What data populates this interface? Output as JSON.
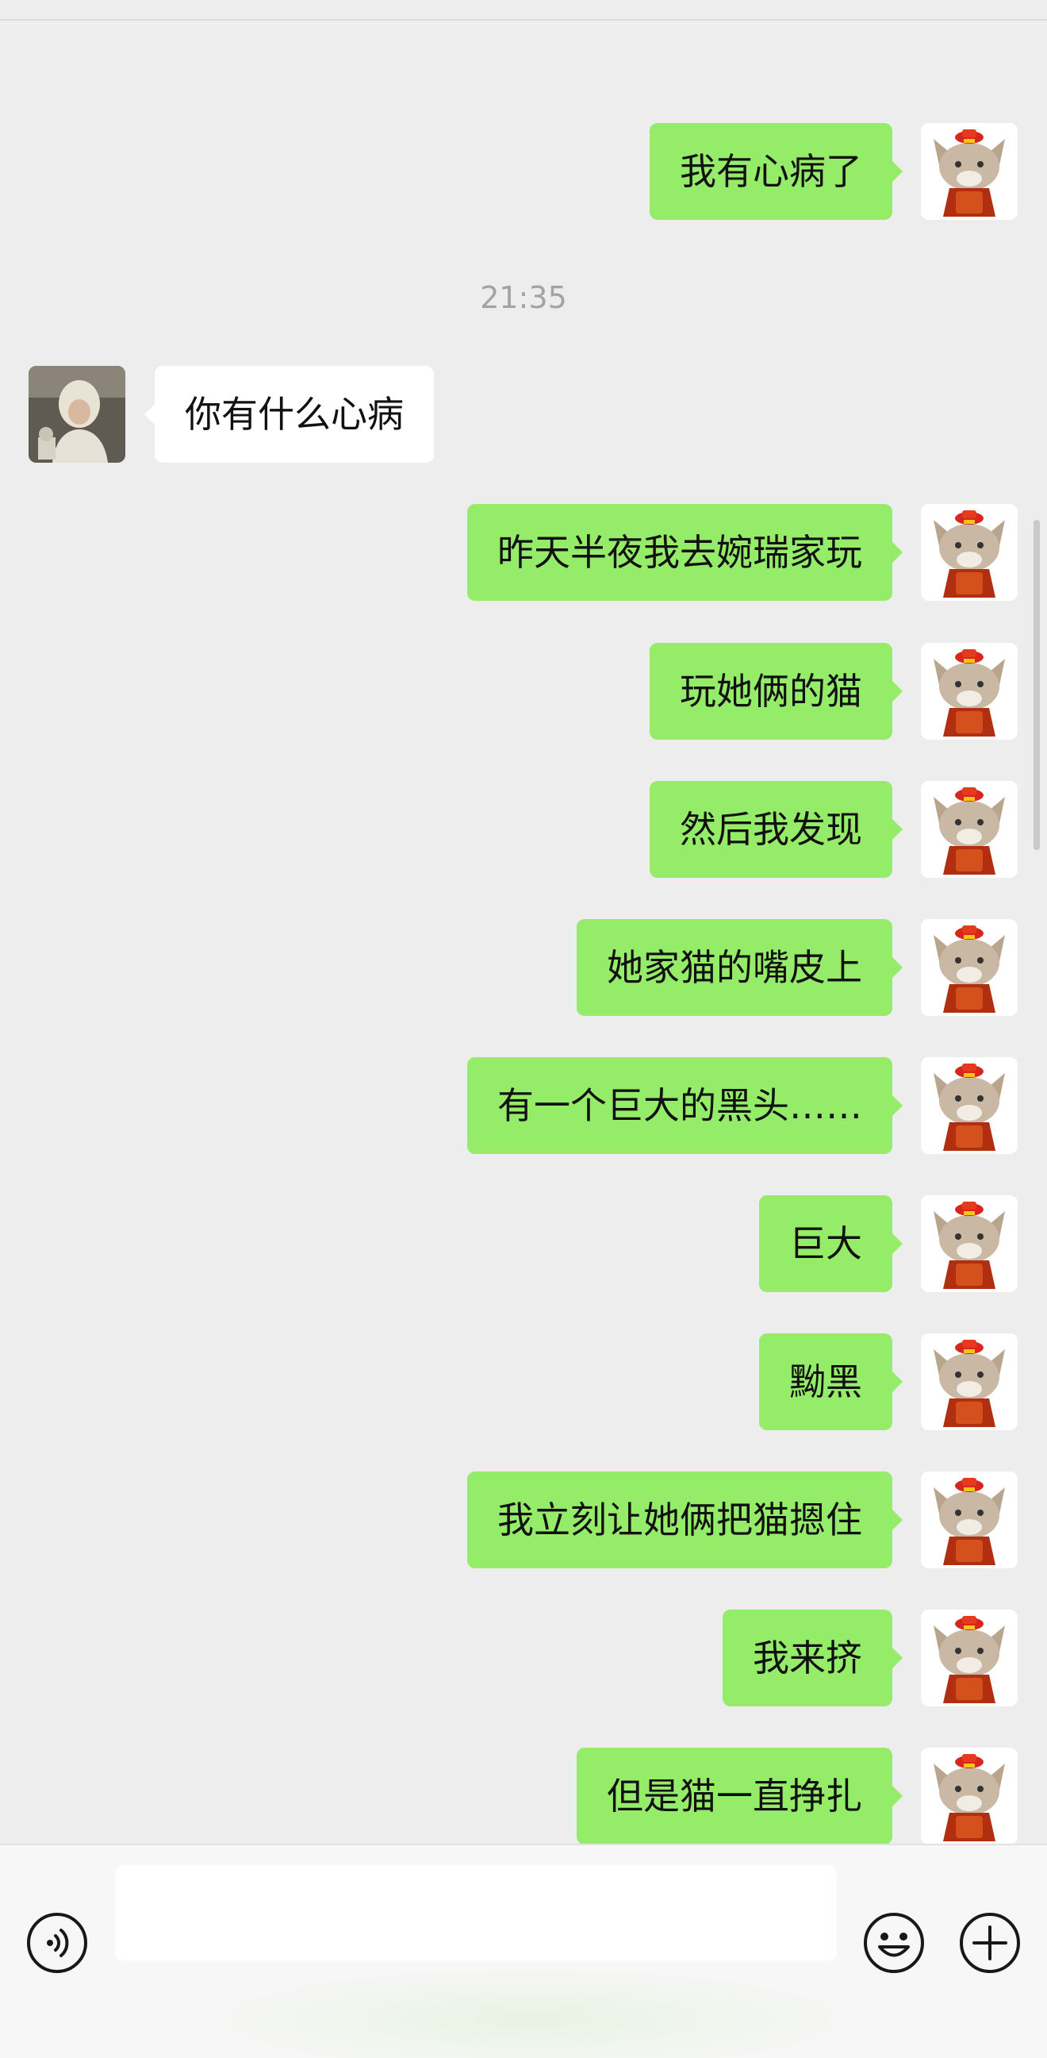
{
  "chat": {
    "timestamp": "21:35",
    "messages": [
      {
        "from": "me",
        "text": "我有心病了"
      },
      {
        "from": "other",
        "text": "你有什么心病"
      },
      {
        "from": "me",
        "text": "昨天半夜我去婉瑞家玩"
      },
      {
        "from": "me",
        "text": "玩她俩的猫"
      },
      {
        "from": "me",
        "text": "然后我发现"
      },
      {
        "from": "me",
        "text": "她家猫的嘴皮上"
      },
      {
        "from": "me",
        "text": "有一个巨大的黑头……"
      },
      {
        "from": "me",
        "text": "巨大"
      },
      {
        "from": "me",
        "text": "黝黑"
      },
      {
        "from": "me",
        "text": "我立刻让她俩把猫摁住"
      },
      {
        "from": "me",
        "text": "我来挤"
      },
      {
        "from": "me",
        "text": "但是猫一直挣扎"
      }
    ]
  },
  "input_bar": {
    "voice_icon": "voice-icon",
    "emoji_icon": "emoji-icon",
    "plus_icon": "plus-icon",
    "input_value": ""
  },
  "colors": {
    "background": "#ededed",
    "bubble_me": "#95ec69",
    "bubble_other": "#ffffff",
    "timestamp_text": "#a3a3a3"
  }
}
